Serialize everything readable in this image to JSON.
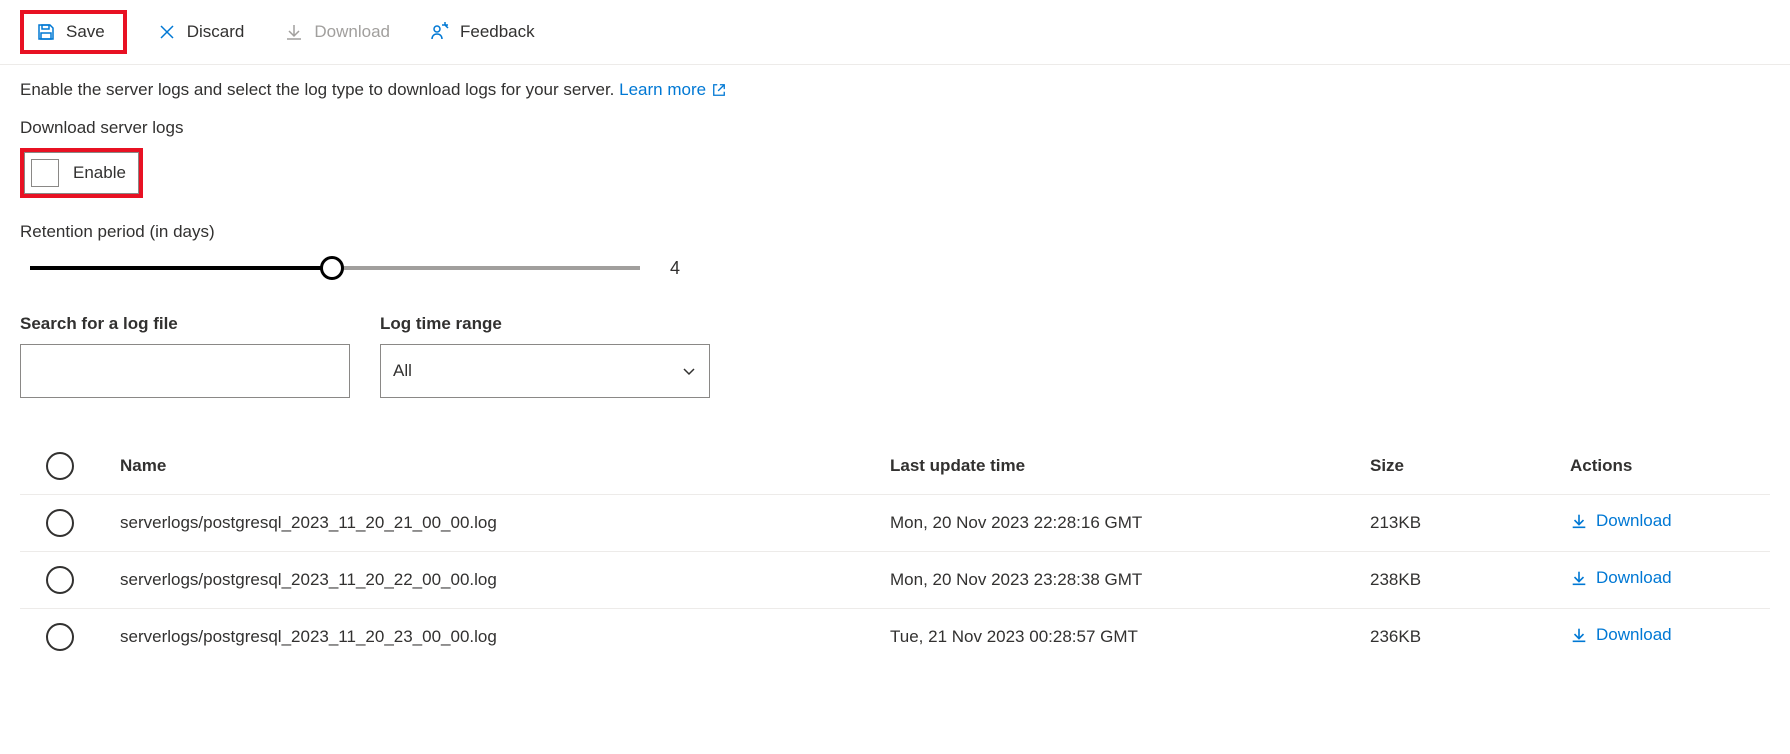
{
  "toolbar": {
    "save_label": "Save",
    "discard_label": "Discard",
    "download_label": "Download",
    "feedback_label": "Feedback"
  },
  "description_text": "Enable the server logs and select the log type to download logs for your server.",
  "learn_more_label": "Learn more",
  "download_logs_label": "Download server logs",
  "enable_label": "Enable",
  "retention_label": "Retention period (in days)",
  "retention_value": "4",
  "search_label": "Search for a log file",
  "search_value": "",
  "timerange_label": "Log time range",
  "timerange_selected": "All",
  "table": {
    "headers": {
      "name": "Name",
      "last_update": "Last update time",
      "size": "Size",
      "actions": "Actions"
    },
    "rows": [
      {
        "name": "serverlogs/postgresql_2023_11_20_21_00_00.log",
        "last_update": "Mon, 20 Nov 2023 22:28:16 GMT",
        "size": "213KB",
        "action": "Download"
      },
      {
        "name": "serverlogs/postgresql_2023_11_20_22_00_00.log",
        "last_update": "Mon, 20 Nov 2023 23:28:38 GMT",
        "size": "238KB",
        "action": "Download"
      },
      {
        "name": "serverlogs/postgresql_2023_11_20_23_00_00.log",
        "last_update": "Tue, 21 Nov 2023 00:28:57 GMT",
        "size": "236KB",
        "action": "Download"
      }
    ]
  }
}
